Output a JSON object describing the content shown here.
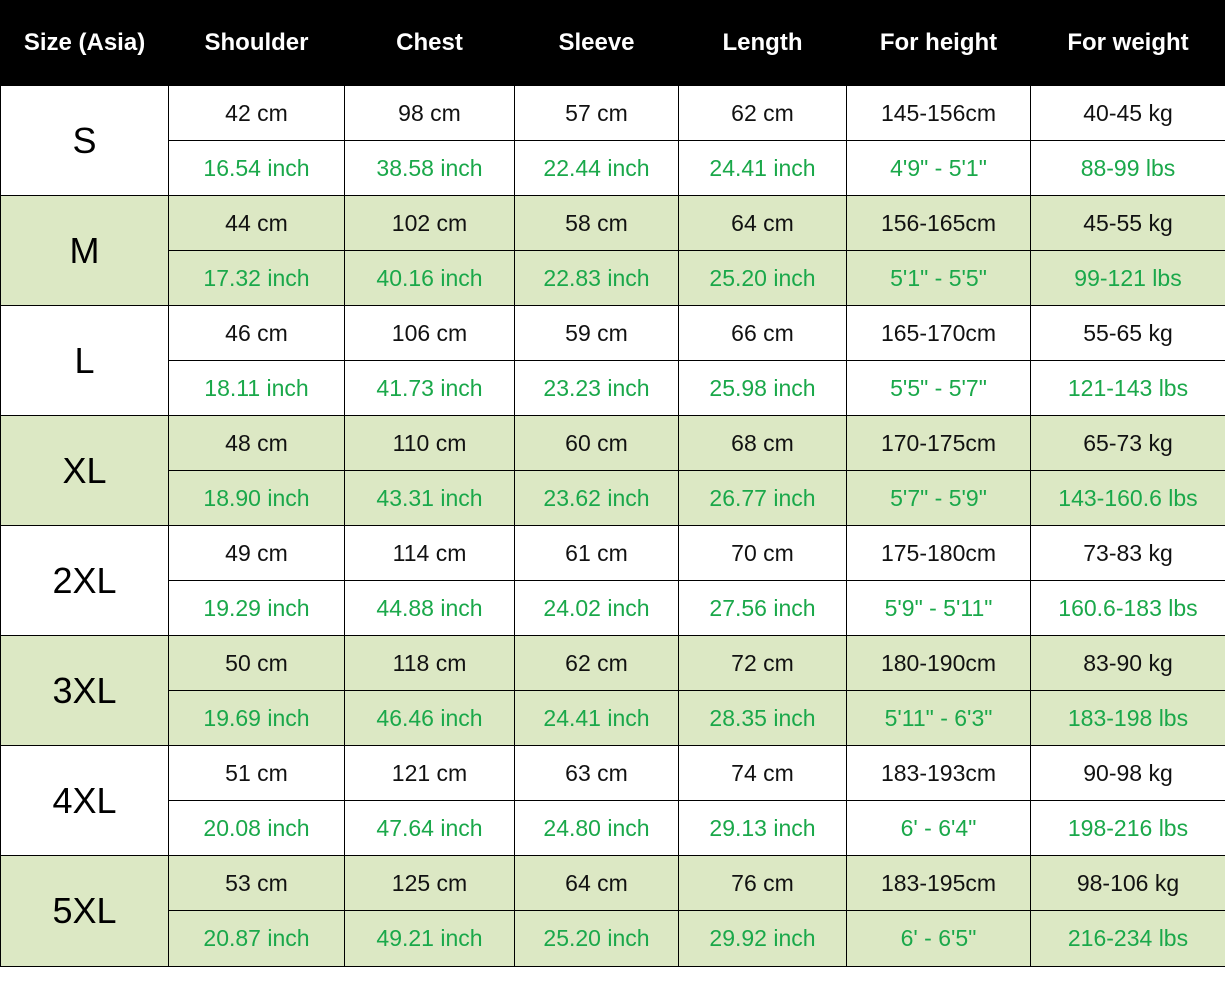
{
  "table": {
    "headers": [
      "Size (Asia)",
      "Shoulder",
      "Chest",
      "Sleeve",
      "Length",
      "For height",
      "For weight"
    ],
    "rows": [
      {
        "size": "S",
        "metric": [
          "42 cm",
          "98 cm",
          "57 cm",
          "62 cm",
          "145-156cm",
          "40-45 kg"
        ],
        "imperial": [
          "16.54 inch",
          "38.58 inch",
          "22.44 inch",
          "24.41 inch",
          "4'9\" - 5'1\"",
          "88-99 lbs"
        ]
      },
      {
        "size": "M",
        "metric": [
          "44 cm",
          "102 cm",
          "58 cm",
          "64 cm",
          "156-165cm",
          "45-55 kg"
        ],
        "imperial": [
          "17.32 inch",
          "40.16 inch",
          "22.83 inch",
          "25.20 inch",
          "5'1\" - 5'5\"",
          "99-121 lbs"
        ]
      },
      {
        "size": "L",
        "metric": [
          "46 cm",
          "106 cm",
          "59 cm",
          "66 cm",
          "165-170cm",
          "55-65 kg"
        ],
        "imperial": [
          "18.11 inch",
          "41.73 inch",
          "23.23 inch",
          "25.98 inch",
          "5'5\" - 5'7\"",
          "121-143 lbs"
        ]
      },
      {
        "size": "XL",
        "metric": [
          "48 cm",
          "110 cm",
          "60 cm",
          "68 cm",
          "170-175cm",
          "65-73 kg"
        ],
        "imperial": [
          "18.90 inch",
          "43.31 inch",
          "23.62 inch",
          "26.77 inch",
          "5'7\" - 5'9\"",
          "143-160.6 lbs"
        ]
      },
      {
        "size": "2XL",
        "metric": [
          "49 cm",
          "114 cm",
          "61 cm",
          "70 cm",
          "175-180cm",
          "73-83 kg"
        ],
        "imperial": [
          "19.29 inch",
          "44.88 inch",
          "24.02 inch",
          "27.56 inch",
          "5'9\" - 5'11\"",
          "160.6-183 lbs"
        ]
      },
      {
        "size": "3XL",
        "metric": [
          "50 cm",
          "118 cm",
          "62 cm",
          "72 cm",
          "180-190cm",
          "83-90 kg"
        ],
        "imperial": [
          "19.69 inch",
          "46.46 inch",
          "24.41 inch",
          "28.35 inch",
          "5'11\" - 6'3\"",
          "183-198 lbs"
        ]
      },
      {
        "size": "4XL",
        "metric": [
          "51 cm",
          "121 cm",
          "63 cm",
          "74 cm",
          "183-193cm",
          "90-98 kg"
        ],
        "imperial": [
          "20.08 inch",
          "47.64 inch",
          "24.80 inch",
          "29.13 inch",
          "6' - 6'4\"",
          "198-216 lbs"
        ]
      },
      {
        "size": "5XL",
        "metric": [
          "53 cm",
          "125 cm",
          "64 cm",
          "76 cm",
          "183-195cm",
          "98-106 kg"
        ],
        "imperial": [
          "20.87 inch",
          "49.21 inch",
          "25.20 inch",
          "29.92 inch",
          "6' - 6'5\"",
          "216-234 lbs"
        ]
      }
    ]
  },
  "colors": {
    "header_bg": "#000000",
    "header_text": "#ffffff",
    "band_alt_bg": "#dce8c4",
    "imperial_text": "#1aa84a",
    "metric_text": "#111111"
  }
}
